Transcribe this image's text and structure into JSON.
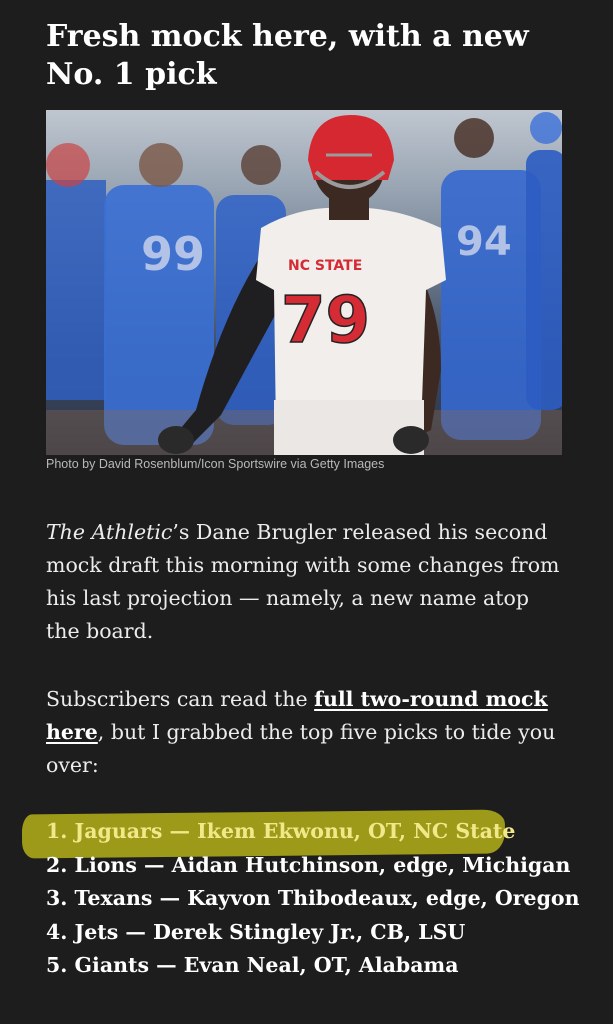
{
  "article": {
    "headline": "Fresh mock here, with a new No. 1 pick",
    "photo_caption": "Photo by David Rosenblum/Icon Sportswire via Getty Images",
    "photo_alt": "",
    "paragraph1": {
      "italic_lead": "The Athletic",
      "rest": "’s Dane Brugler released his second mock draft this morning with some changes from his last projection — namely, a new name atop the board."
    },
    "paragraph2": {
      "before_link": "Subscribers can read the ",
      "link_text": "full two-round mock here",
      "after_link": ", but I grabbed the top five picks to tide you over:"
    },
    "picks": [
      "1. Jaguars — Ikem Ekwonu, OT, NC State",
      "2. Lions — Aidan Hutchinson, edge, Michigan",
      "3. Texans — Kayvon Thibodeaux, edge, Oregon",
      "4. Jets — Derek Stingley Jr., CB, LSU",
      "5. Giants — Evan Neal, OT, Alabama"
    ],
    "photo_jersey": {
      "team_text": "NC STATE",
      "number": "79"
    }
  },
  "colors": {
    "background": "#1d1d1d",
    "highlight": "#a8a51a",
    "highlight_text": "#f2e88a"
  }
}
